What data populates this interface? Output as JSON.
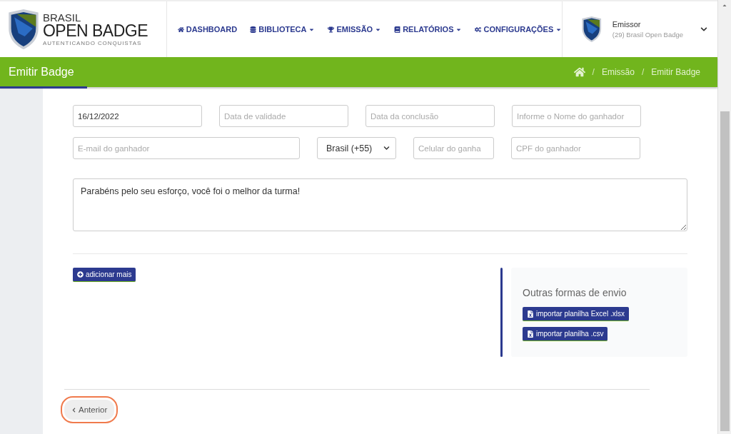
{
  "logo": {
    "line_1": "BRASIL",
    "line_2": "OPEN BADGE",
    "tagline": "AUTENTICANDO CONQUISTAS"
  },
  "nav": [
    {
      "label": "DASHBOARD",
      "dropdown": false
    },
    {
      "label": "BIBLIOTECA",
      "dropdown": true
    },
    {
      "label": "EMISSÃO",
      "dropdown": true
    },
    {
      "label": "RELATÓRIOS",
      "dropdown": true
    },
    {
      "label": "CONFIGURAÇÕES",
      "dropdown": true
    }
  ],
  "user": {
    "role": "Emissor",
    "organization": "(29) Brasil Open Badge"
  },
  "page_bar": {
    "title": "Emitir Badge",
    "breadcrumb": [
      {
        "separator": "/",
        "label": "Emissão"
      },
      {
        "separator": "/",
        "label": "Emitir Badge"
      }
    ]
  },
  "fields_row_1": [
    {
      "kind": "input",
      "value": "16/12/2022"
    },
    {
      "kind": "input",
      "placeholder": "Data de validade"
    },
    {
      "kind": "input",
      "placeholder": "Data da conclusão"
    },
    {
      "kind": "input",
      "placeholder": "Informe o Nome do ganhador"
    }
  ],
  "fields_row_2": [
    {
      "kind": "input",
      "placeholder": "E-mail do ganhador"
    },
    {
      "kind": "select",
      "value": "Brasil (+55)"
    },
    {
      "kind": "input",
      "placeholder": "Celular do ganha"
    },
    {
      "kind": "input",
      "placeholder": "CPF do ganhador"
    }
  ],
  "message": {
    "value": "Parabéns pelo seu esforço, você foi o melhor da turma!"
  },
  "add_more_button": "adicionar mais",
  "other_options": {
    "title": "Outras formas de envio",
    "buttons": [
      "importar planilha Excel .xlsx",
      "importar planilha .csv"
    ]
  },
  "previous_button": {
    "label": "Anterior",
    "focused": true
  }
}
